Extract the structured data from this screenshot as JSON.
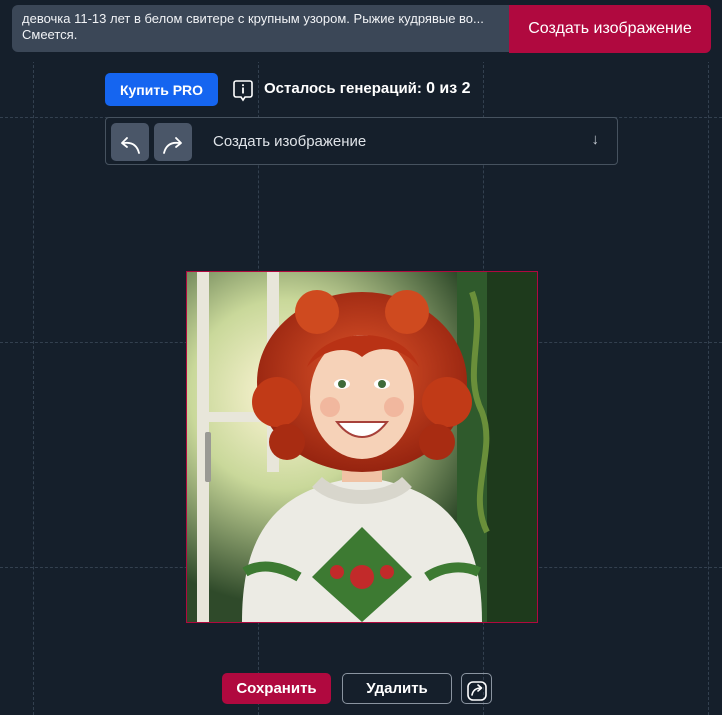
{
  "prompt": {
    "text": "девочка 11-13 лет в белом свитере с крупным узором. Рыжие кудрявые во... Смеется."
  },
  "top": {
    "create_label": "Создать изображение"
  },
  "account": {
    "buy_pro_label": "Купить PRO",
    "generations_label": "Осталось генераций:",
    "generations_value": "0 из 2"
  },
  "toolbar": {
    "mode_label": "Создать изображение",
    "mode_arrow": "↓"
  },
  "actions": {
    "save_label": "Сохранить",
    "delete_label": "Удалить"
  },
  "colors": {
    "background": "#151f2b",
    "accent": "#b0093f",
    "pro": "#1565f0"
  },
  "icons": [
    "undo-icon",
    "redo-icon",
    "info-icon",
    "share-icon",
    "chevron-down-icon"
  ]
}
